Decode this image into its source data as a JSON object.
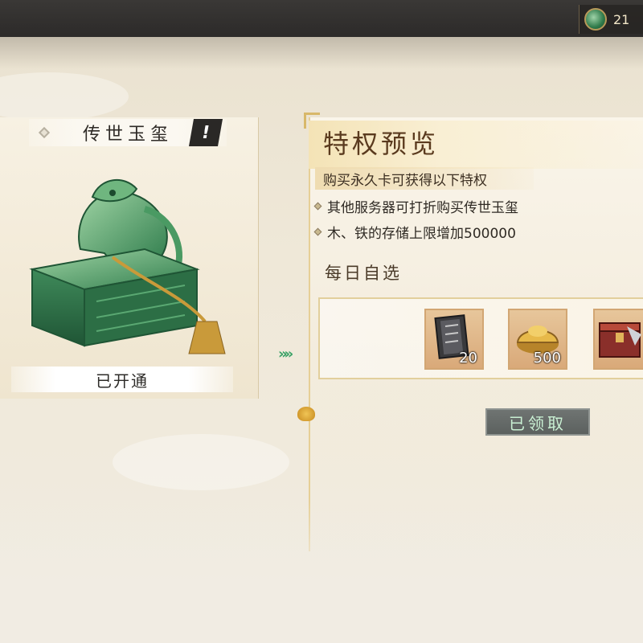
{
  "currency": {
    "icon": "jade-dragon-coin-icon",
    "value": "21"
  },
  "seal_card": {
    "title": "传世玉玺",
    "info_icon": "exclamation-icon",
    "info_glyph": "!",
    "status": "已开通"
  },
  "privilege": {
    "title": "特权预览",
    "subtitle": "购买永久卡可获得以下特权",
    "benefits": [
      "其他服务器可打折购买传世玉玺",
      "木、铁的存储上限增加500000"
    ],
    "daily_label": "每日自选",
    "items": [
      {
        "name": "token-book",
        "quantity": "20"
      },
      {
        "name": "gold-ingot",
        "quantity": "500"
      },
      {
        "name": "treasure-chest",
        "quantity": ""
      }
    ],
    "claimed_button": "已领取"
  },
  "arrows_glyph": "»»",
  "colors": {
    "title_brown": "#5a3a1e",
    "claimed_text": "#c9f0d3",
    "arrow_green": "#3aa266",
    "item_border": "#d2a673"
  }
}
